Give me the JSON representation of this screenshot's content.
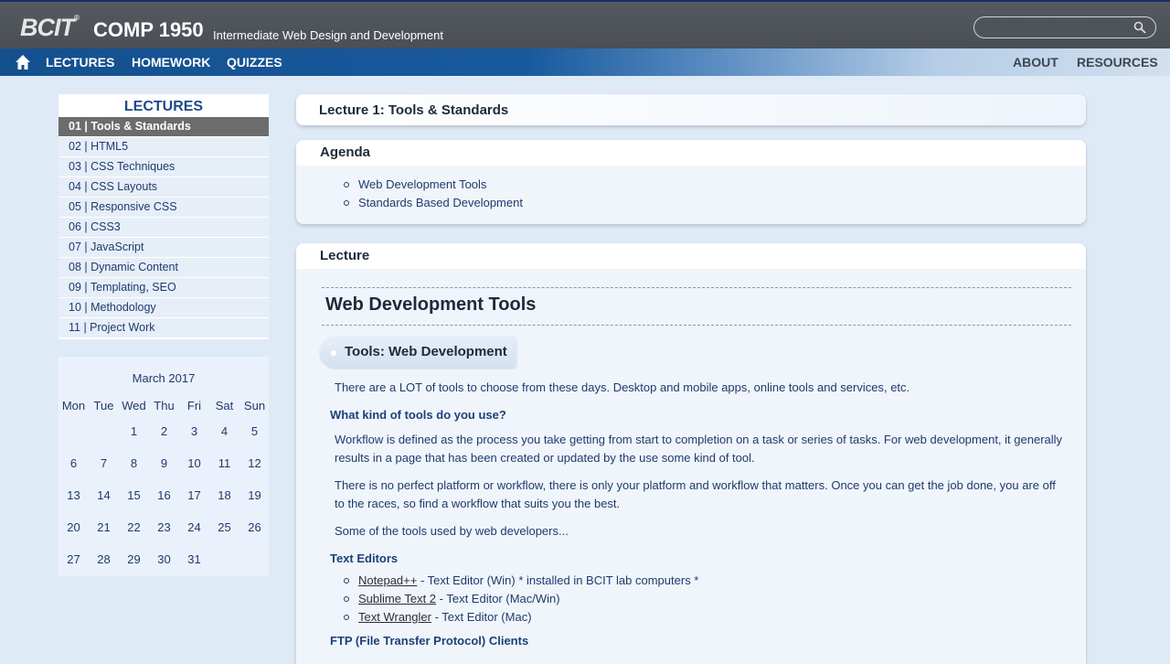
{
  "header": {
    "logo": "BCIT",
    "logo_mark": "®",
    "course_code": "COMP 1950",
    "course_subtitle": "Intermediate Web Design and Development",
    "search_placeholder": ""
  },
  "nav": {
    "left": [
      "LECTURES",
      "HOMEWORK",
      "QUIZZES"
    ],
    "right": [
      "ABOUT",
      "RESOURCES"
    ]
  },
  "sidebar": {
    "title": "LECTURES",
    "items": [
      {
        "label": "01 | Tools & Standards",
        "active": true
      },
      {
        "label": "02 | HTML5"
      },
      {
        "label": "03 | CSS Techniques"
      },
      {
        "label": "04 | CSS Layouts"
      },
      {
        "label": "05 | Responsive CSS"
      },
      {
        "label": "06 | CSS3"
      },
      {
        "label": "07 | JavaScript"
      },
      {
        "label": "08 | Dynamic Content"
      },
      {
        "label": "09 | Templating, SEO"
      },
      {
        "label": "10 | Methodology"
      },
      {
        "label": "11 | Project Work"
      }
    ]
  },
  "calendar": {
    "month": "March 2017",
    "weekdays": [
      "Mon",
      "Tue",
      "Wed",
      "Thu",
      "Fri",
      "Sat",
      "Sun"
    ],
    "weeks": [
      [
        "",
        "",
        "1",
        "2",
        "3",
        "4",
        "5"
      ],
      [
        "6",
        "7",
        "8",
        "9",
        "10",
        "11",
        "12"
      ],
      [
        "13",
        "14",
        "15",
        "16",
        "17",
        "18",
        "19"
      ],
      [
        "20",
        "21",
        "22",
        "23",
        "24",
        "25",
        "26"
      ],
      [
        "27",
        "28",
        "29",
        "30",
        "31",
        "",
        ""
      ]
    ]
  },
  "main": {
    "page_title": "Lecture 1: Tools & Standards",
    "agenda": {
      "heading": "Agenda",
      "items": [
        "Web Development Tools",
        "Standards Based Development"
      ]
    },
    "lecture": {
      "heading": "Lecture",
      "section_title": "Web Development Tools",
      "subsection": "Tools: Web Development",
      "intro": "There are a LOT of tools to choose from these days. Desktop and mobile apps, online tools and services, etc.",
      "q_heading": "What kind of tools do you use?",
      "para1": "Workflow is defined as the process you take getting from start to completion on a task or series of tasks. For web development, it generally results in a page that has been created or updated by the use some kind of tool.",
      "para2": "There is no perfect platform or workflow, there is only your platform and workflow that matters. Once you can get the job done, you are off to the races, so find a workflow that suits you the best.",
      "para3": "Some of the tools used by web developers...",
      "editors_heading": "Text Editors",
      "editors": [
        {
          "name": "Notepad++",
          "desc": " - Text Editor (Win) * installed in BCIT lab computers *"
        },
        {
          "name": "Sublime Text 2",
          "desc": " - Text Editor (Mac/Win)"
        },
        {
          "name": "Text Wrangler",
          "desc": " - Text Editor (Mac)"
        }
      ],
      "ftp_heading": "FTP (File Transfer Protocol) Clients"
    }
  }
}
